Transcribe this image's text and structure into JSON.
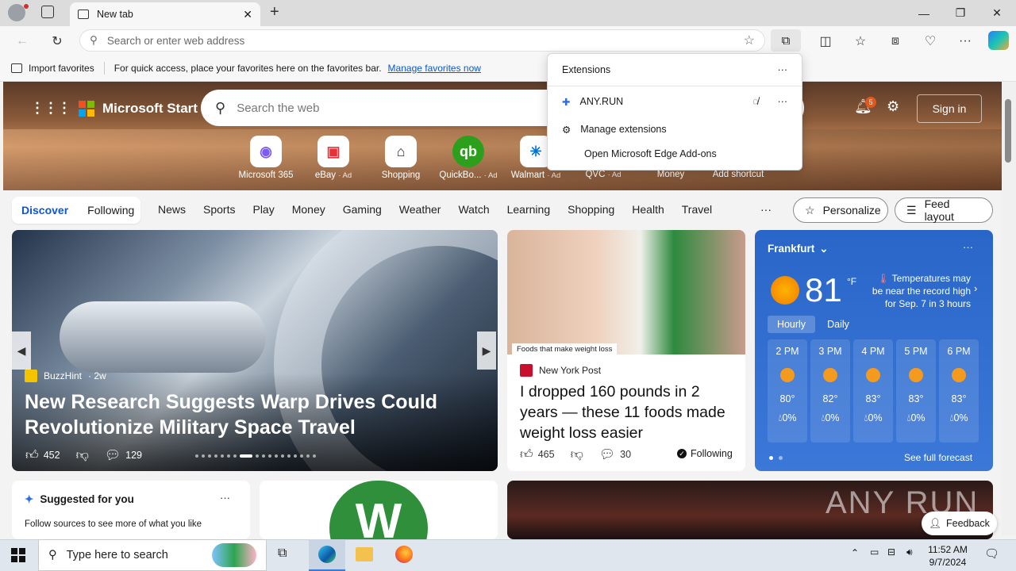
{
  "browser": {
    "tab_title": "New tab",
    "address_placeholder": "Search or enter web address",
    "favbar": {
      "import_label": "Import favorites",
      "hint": "For quick access, place your favorites here on the favorites bar.",
      "manage_link": "Manage favorites now"
    }
  },
  "extensions_popup": {
    "title": "Extensions",
    "items": [
      {
        "name": "ANY.RUN"
      }
    ],
    "manage": "Manage extensions",
    "addons": "Open Microsoft Edge Add-ons"
  },
  "msstart": {
    "brand": "Microsoft Start",
    "search_placeholder": "Search the web",
    "notification_count": "5",
    "signin": "Sign in",
    "shortcuts": [
      {
        "label": "Microsoft 365",
        "ad": ""
      },
      {
        "label": "eBay",
        "ad": "· Ad"
      },
      {
        "label": "Shopping",
        "ad": ""
      },
      {
        "label": "QuickBo...",
        "ad": "· Ad"
      },
      {
        "label": "Walmart",
        "ad": "· Ad"
      },
      {
        "label": "QVC",
        "ad": "· Ad"
      },
      {
        "label": "Money",
        "ad": ""
      },
      {
        "label": "Add shortcut",
        "ad": ""
      }
    ],
    "nav": {
      "discover": "Discover",
      "following": "Following",
      "items": [
        "News",
        "Sports",
        "Play",
        "Money",
        "Gaming",
        "Weather",
        "Watch",
        "Learning",
        "Shopping",
        "Health",
        "Travel"
      ],
      "more": "···",
      "personalize": "Personalize",
      "feed_layout": "Feed layout"
    }
  },
  "cards": {
    "main": {
      "source": "BuzzHint",
      "age": "· 2w",
      "headline": "New Research Suggests Warp Drives Could Revolutionize Military Space Travel",
      "likes": "452",
      "comments": "129"
    },
    "second": {
      "image_tag": "Foods that make weight loss",
      "source": "New York Post",
      "headline": "I dropped 160 pounds in 2 years — these 11 foods made weight loss easier",
      "likes": "465",
      "comments": "30",
      "following": "Following"
    },
    "weather": {
      "city": "Frankfurt",
      "temp": "81",
      "unit": "°F",
      "alert": "Temperatures may be near the record high for Sep. 7 in 3 hours",
      "tab_hourly": "Hourly",
      "tab_daily": "Daily",
      "hours": [
        {
          "time": "2 PM",
          "temp": "80°",
          "precip": "0%"
        },
        {
          "time": "3 PM",
          "temp": "82°",
          "precip": "0%"
        },
        {
          "time": "4 PM",
          "temp": "83°",
          "precip": "0%"
        },
        {
          "time": "5 PM",
          "temp": "83°",
          "precip": "0%"
        },
        {
          "time": "6 PM",
          "temp": "83°",
          "precip": "0%"
        }
      ],
      "see_forecast": "See full forecast"
    },
    "suggested": {
      "title": "Suggested for you",
      "subtitle": "Follow sources to see more of what you like"
    }
  },
  "feedback": "Feedback",
  "watermark": "ANY RUN",
  "taskbar": {
    "search_placeholder": "Type here to search",
    "time": "11:52 AM",
    "date": "9/7/2024"
  }
}
